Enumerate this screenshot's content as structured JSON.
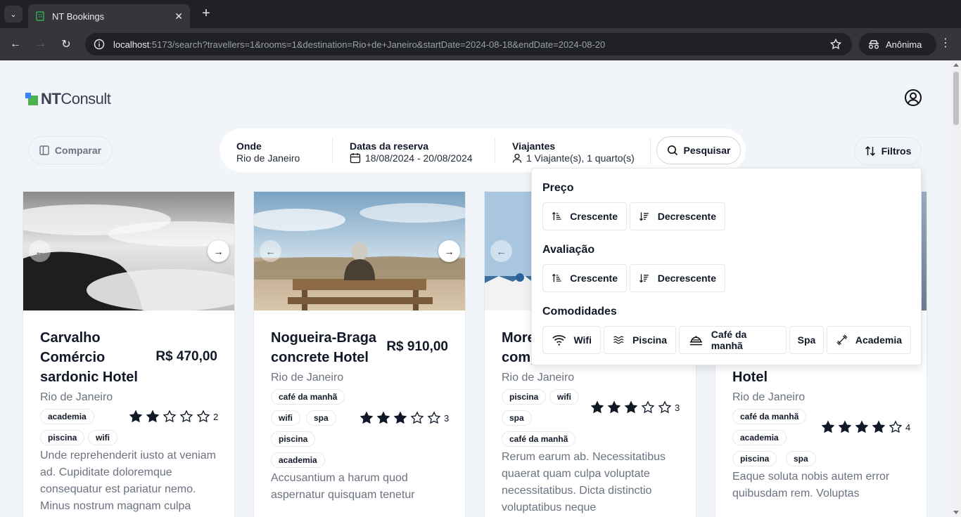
{
  "browser": {
    "tab_title": "NT Bookings",
    "url_host": "localhost",
    "url_rest": ":5173/search?travellers=1&rooms=1&destination=Rio+de+Janeiro&startDate=2024-08-18&endDate=2024-08-20",
    "profile_label": "Anônima"
  },
  "header": {
    "logo_bold": "NT",
    "logo_light": "Consult"
  },
  "toolbar": {
    "compare_label": "Comparar",
    "filters_label": "Filtros"
  },
  "search": {
    "where_label": "Onde",
    "where_value": "Rio de Janeiro",
    "dates_label": "Datas da reserva",
    "dates_value": "18/08/2024 - 20/08/2024",
    "travellers_label": "Viajantes",
    "travellers_value": "1 Viajante(s), 1 quarto(s)",
    "search_label": "Pesquisar"
  },
  "hotels": [
    {
      "name_lines": [
        "Carvalho",
        "Comércio",
        "sardonic Hotel"
      ],
      "price": "R$ 470,00",
      "city": "Rio de Janeiro",
      "tags": [
        "academia",
        "piscina",
        "wifi"
      ],
      "rating": 2,
      "rating_label": "2",
      "description": "Unde reprehenderit iusto at veniam ad. Cupiditate doloremque consequatur est pariatur nemo. Minus nostrum magnam culpa"
    },
    {
      "name_lines": [
        "Nogueira-Braga",
        "concrete Hotel"
      ],
      "price": "R$ 910,00",
      "city": "Rio de Janeiro",
      "tags": [
        "café da manhã",
        "wifi",
        "spa",
        "piscina",
        "academia"
      ],
      "rating": 3,
      "rating_label": "3",
      "description": "Accusantium a harum quod aspernatur quisquam tenetur"
    },
    {
      "name_lines": [
        "More",
        "comp"
      ],
      "price": "",
      "city": "Rio de Janeiro",
      "tags": [
        "piscina",
        "wifi",
        "spa",
        "café da manhã"
      ],
      "rating": 3,
      "rating_label": "3",
      "description": "Rerum earum ab. Necessitatibus quaerat quam culpa voluptate necessitatibus. Dicta distinctio voluptatibus neque"
    },
    {
      "name_lines": [
        "Hotel"
      ],
      "price": "",
      "city": "Rio de Janeiro",
      "tags": [
        "café da manhã",
        "academia",
        "piscina",
        "spa"
      ],
      "rating": 4,
      "rating_label": "4",
      "description": "Eaque soluta nobis autem error quibusdam rem. Voluptas"
    }
  ],
  "filters_panel": {
    "price_title": "Preço",
    "rating_title": "Avaliação",
    "amenities_title": "Comodidades",
    "asc_label": "Crescente",
    "desc_label": "Decrescente",
    "amenities": [
      "Wifi",
      "Piscina",
      "Café da manhã",
      "Spa",
      "Academia"
    ]
  }
}
